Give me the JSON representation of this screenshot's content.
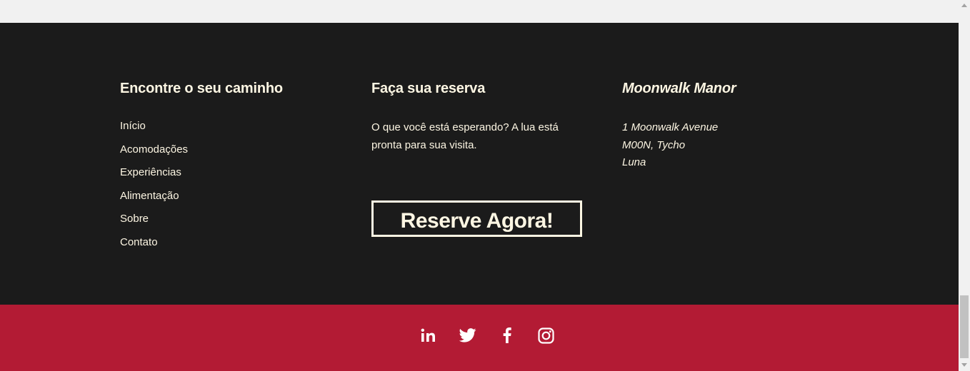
{
  "nav_column": {
    "heading": "Encontre o seu caminho",
    "links": [
      "Início",
      "Acomodações",
      "Experiências",
      "Alimentação",
      "Sobre",
      "Contato"
    ]
  },
  "booking_column": {
    "heading": "Faça sua reserva",
    "blurb": "O que você está esperando? A lua está pronta para sua visita.",
    "button_label": "Reserve Agora!"
  },
  "address_column": {
    "heading": "Moonwalk Manor",
    "lines": [
      "1 Moonwalk Avenue",
      "M00N, Tycho",
      "Luna"
    ]
  },
  "social": {
    "icons": [
      "linkedin-icon",
      "twitter-icon",
      "facebook-icon",
      "instagram-icon"
    ]
  },
  "colors": {
    "footer_background": "#1b1b1b",
    "bottom_bar": "#b31b34",
    "text": "#fdf6e3"
  }
}
